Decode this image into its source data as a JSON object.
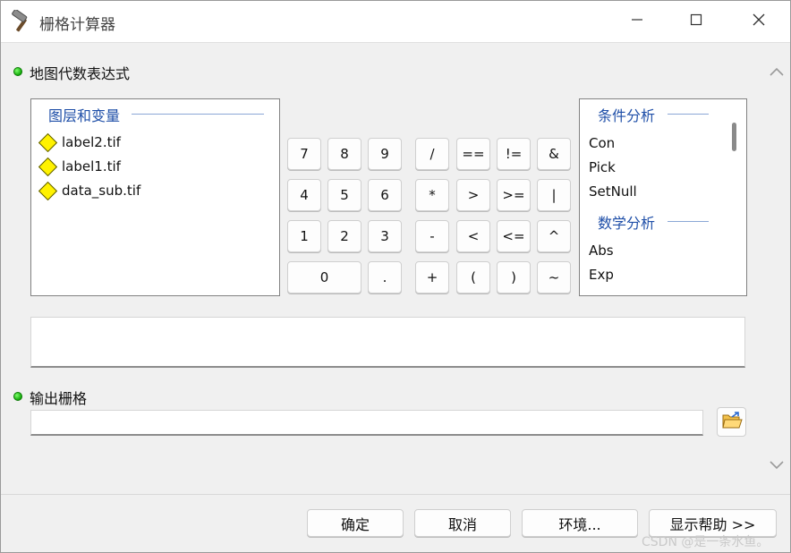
{
  "window": {
    "title": "栅格计算器",
    "minimize_symbol": "—",
    "maximize_symbol": "☐",
    "close_symbol": "✕"
  },
  "map_algebra": {
    "section_label": "地图代数表达式",
    "layers_group_title": "图层和变量",
    "layers": [
      "label2.tif",
      "label1.tif",
      "data_sub.tif"
    ]
  },
  "keypad": {
    "row1": [
      "7",
      "8",
      "9",
      "/",
      "==",
      "!=",
      "&"
    ],
    "row2": [
      "4",
      "5",
      "6",
      "*",
      ">",
      ">=",
      "|"
    ],
    "row3": [
      "1",
      "2",
      "3",
      "-",
      "<",
      "<=",
      "^"
    ],
    "row4": [
      "0",
      ".",
      "+",
      "(",
      ")",
      "~"
    ]
  },
  "functions": {
    "group1_title": "条件分析",
    "group1_items": [
      "Con",
      "Pick",
      "SetNull"
    ],
    "group2_title": "数学分析",
    "group2_items": [
      "Abs",
      "Exp"
    ]
  },
  "expression": {
    "value": ""
  },
  "output": {
    "section_label": "输出栅格",
    "value": ""
  },
  "buttons": {
    "ok": "确定",
    "cancel": "取消",
    "environments": "环境...",
    "show_help": "显示帮助 >>"
  },
  "watermark": "CSDN @是一条水鱼。",
  "colors": {
    "group_title": "#1f4fa8",
    "status_dot": "#13a80a",
    "layer_icon": "#fff200"
  },
  "icons": {
    "app": "hammer-icon",
    "layer": "raster-layer-icon",
    "browse": "open-folder-icon"
  }
}
